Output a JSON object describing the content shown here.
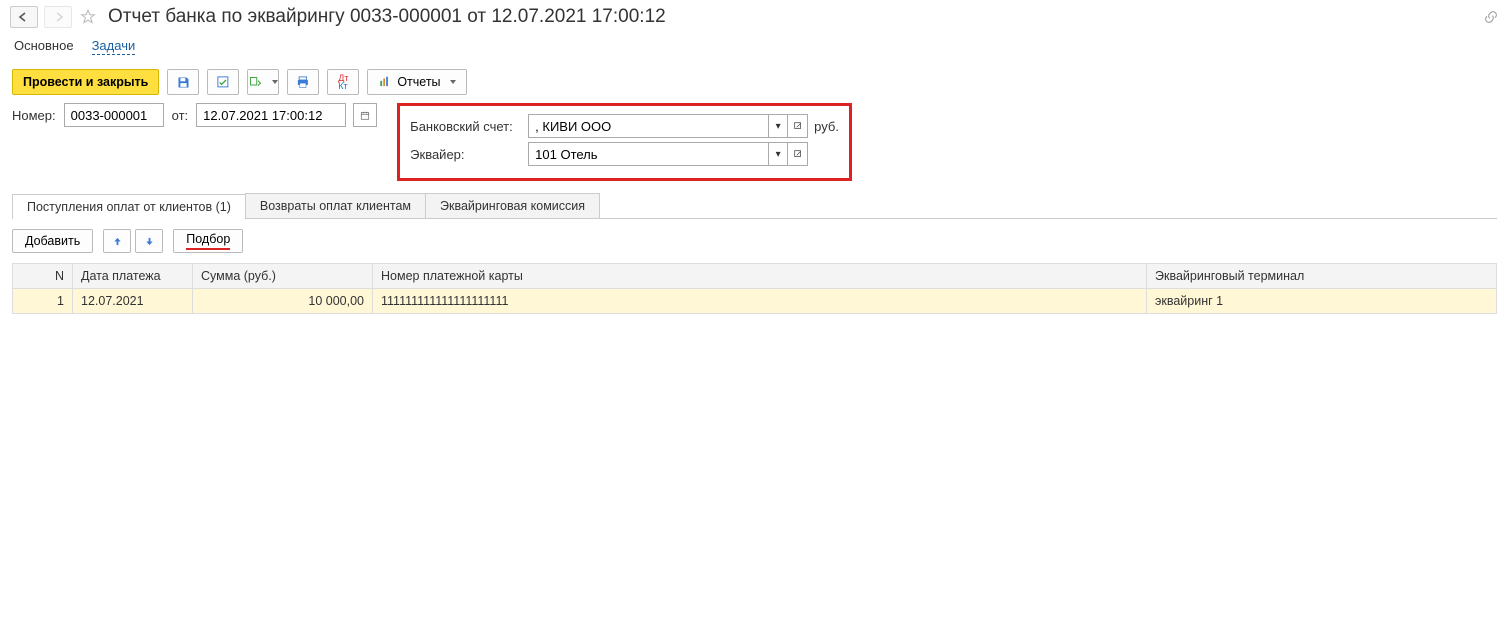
{
  "header": {
    "title": "Отчет банка по эквайрингу 0033-000001 от 12.07.2021 17:00:12"
  },
  "subnav": {
    "main": "Основное",
    "tasks": "Задачи"
  },
  "toolbar": {
    "post_close": "Провести и закрыть",
    "reports": "Отчеты"
  },
  "form": {
    "number_label": "Номер:",
    "number_value": "0033-000001",
    "from_label": "от:",
    "date_value": "12.07.2021 17:00:12",
    "bank_account_label": "Банковский счет:",
    "bank_account_value": ", КИВИ ООО",
    "currency": "руб.",
    "acquirer_label": "Эквайер:",
    "acquirer_value": "101 Отель"
  },
  "tabs": {
    "incoming": "Поступления оплат от клиентов (1)",
    "returns": "Возвраты оплат клиентам",
    "commission": "Эквайринговая комиссия"
  },
  "tab_actions": {
    "add": "Добавить",
    "pick": "Подбор"
  },
  "grid": {
    "columns": {
      "n": "N",
      "date": "Дата платежа",
      "sum": "Сумма (руб.)",
      "card": "Номер платежной карты",
      "terminal": "Эквайринговый терминал"
    },
    "rows": [
      {
        "n": "1",
        "date": "12.07.2021",
        "sum": "10 000,00",
        "card": "111111111111111111111",
        "terminal": "эквайринг 1"
      }
    ]
  }
}
